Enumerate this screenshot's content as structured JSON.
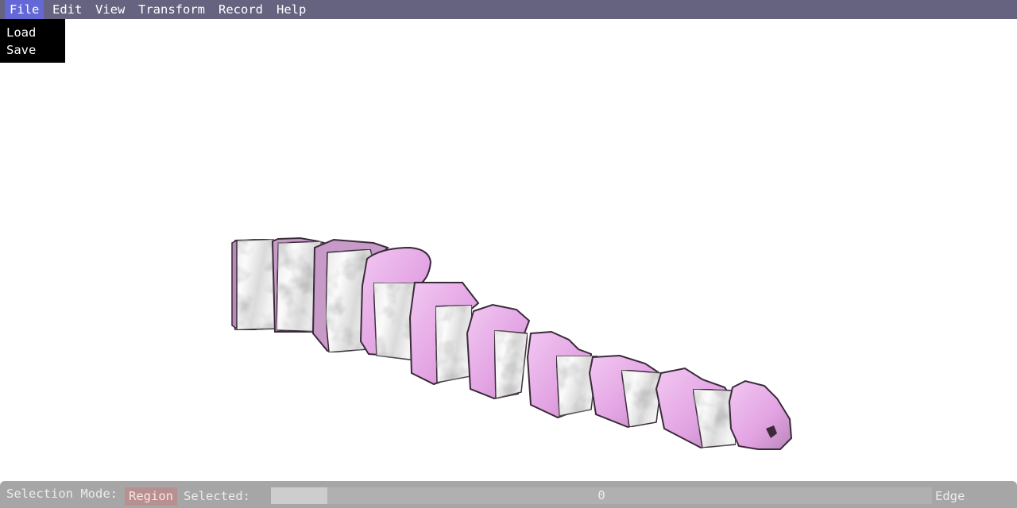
{
  "menubar": {
    "items": [
      "File",
      "Edit",
      "View",
      "Transform",
      "Record",
      "Help"
    ],
    "active": "File"
  },
  "file_menu": {
    "items": [
      "Load",
      "Save"
    ]
  },
  "viewport": {
    "model": "spine-vertebrae-mesh",
    "colors": {
      "selected_face": "#e6a6e6",
      "bone_surface": "#f2f2f2",
      "edge": "#3a2a3a"
    }
  },
  "status": {
    "selection_mode_label": "Selection Mode:",
    "mode_value": "Region",
    "selected_label": "Selected:",
    "selected_count": "0",
    "selected_fraction": 0.085,
    "right_label": "Edge"
  },
  "colors": {
    "menubar": "#65637f",
    "menu_active": "#6467d6",
    "statusbar": "#a6a6a6",
    "region_button": "#b99090"
  }
}
